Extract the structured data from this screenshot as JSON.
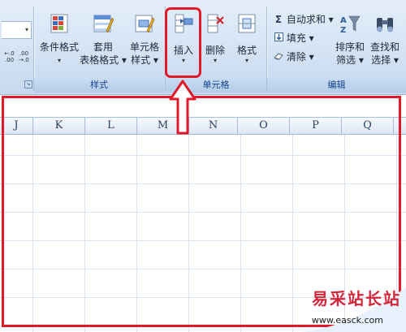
{
  "ribbon": {
    "styles_group": {
      "label": "样式",
      "conditional_format": {
        "label1": "条件格式",
        "caret": "▾"
      },
      "table_format": {
        "label1": "套用",
        "label2": "表格格式 ▾"
      },
      "cell_styles": {
        "label1": "单元格",
        "label2": "样式 ▾"
      }
    },
    "cells_group": {
      "label": "单元格",
      "insert": {
        "label": "插入",
        "caret": "▾"
      },
      "delete": {
        "label": "删除",
        "caret": "▾"
      },
      "format": {
        "label": "格式",
        "caret": "▾"
      }
    },
    "editing_group": {
      "label": "编辑",
      "autosum": {
        "symbol": "Σ",
        "label": "自动求和 ▾"
      },
      "fill": {
        "label": "填充 ▾"
      },
      "clear": {
        "label": "清除 ▾"
      },
      "sort_filter": {
        "label1": "排序和",
        "label2": "筛选 ▾"
      },
      "find_select": {
        "label1": "查找和",
        "label2": "选择 ▾"
      }
    },
    "number_buttons": {
      "increase_decimal": "←.0\n.00",
      "decrease_decimal": ".00\n→.0"
    }
  },
  "columns": [
    "J",
    "K",
    "L",
    "M",
    "N",
    "O",
    "P",
    "Q"
  ],
  "watermark": {
    "text": "易采站长站",
    "url": "www.easck.com"
  },
  "colors": {
    "annotation_red": "#e0192b",
    "ribbon_blue": "#d4e3f4"
  }
}
